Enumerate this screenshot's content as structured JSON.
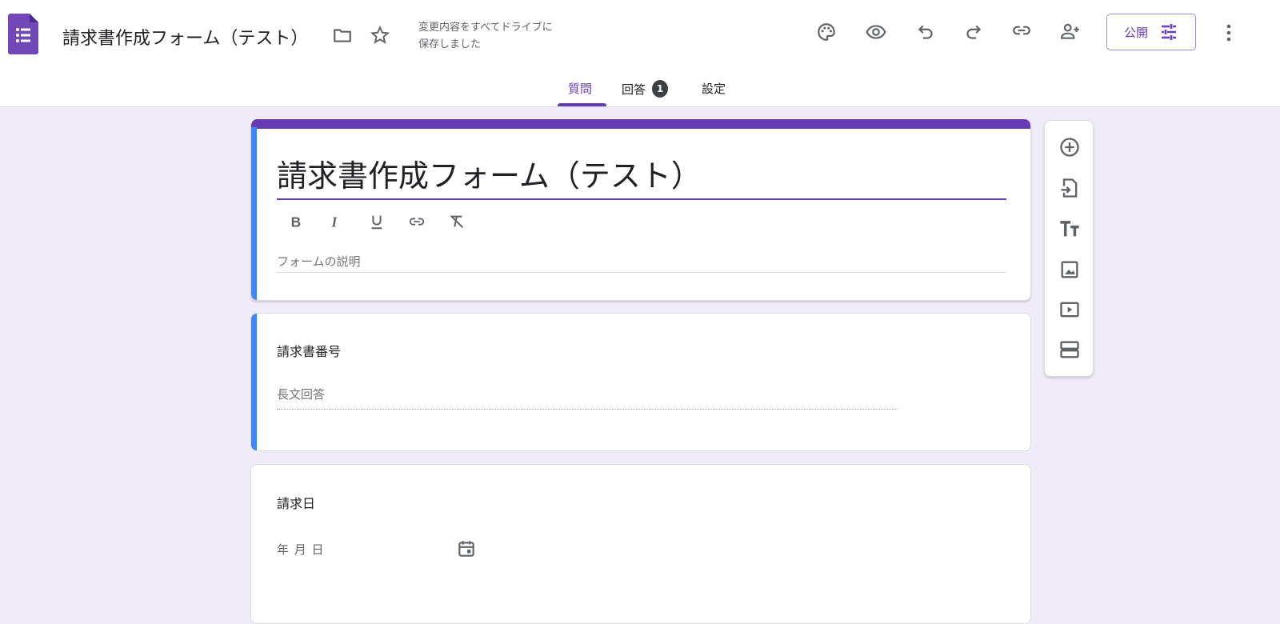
{
  "header": {
    "doc_title": "請求書作成フォーム（テスト）",
    "save_status_line1": "変更内容をすべてドライブに",
    "save_status_line2": "保存しました",
    "publish_label": "公開"
  },
  "tabs": [
    {
      "label": "質問",
      "active": true
    },
    {
      "label": "回答",
      "badge": "1"
    },
    {
      "label": "設定"
    }
  ],
  "form": {
    "title": "請求書作成フォーム（テスト）",
    "description_placeholder": "フォームの説明",
    "questions": [
      {
        "title": "請求書番号",
        "answer_placeholder": "長文回答"
      },
      {
        "title": "請求日",
        "answer_placeholder": "年 月 日"
      }
    ]
  },
  "colors": {
    "accent": "#673ab7",
    "background": "#f0ebf8",
    "selected": "#4285f4"
  }
}
